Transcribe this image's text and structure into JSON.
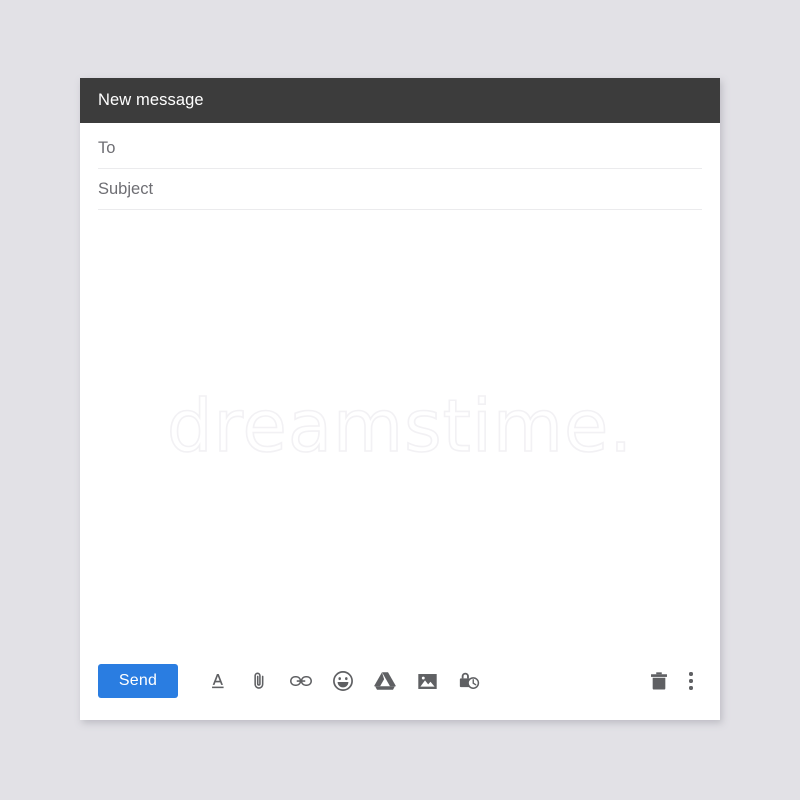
{
  "window": {
    "title": "New message"
  },
  "fields": {
    "to": {
      "label": "To",
      "value": "",
      "placeholder": "To"
    },
    "subject": {
      "label": "Subject",
      "value": "",
      "placeholder": "Subject"
    },
    "body": {
      "value": "",
      "placeholder": ""
    }
  },
  "watermark": {
    "text": "dreamstime."
  },
  "toolbar": {
    "send_label": "Send",
    "tools": [
      {
        "name": "format-options-icon",
        "label": "Formatting options"
      },
      {
        "name": "attach-file-icon",
        "label": "Attach files"
      },
      {
        "name": "insert-link-icon",
        "label": "Insert link"
      },
      {
        "name": "insert-emoji-icon",
        "label": "Insert emoji"
      },
      {
        "name": "google-drive-icon",
        "label": "Insert files using Drive"
      },
      {
        "name": "insert-photo-icon",
        "label": "Insert photo"
      },
      {
        "name": "confidential-mode-icon",
        "label": "Toggle confidential mode"
      }
    ],
    "discard_label": "Discard draft",
    "more_options_label": "More options"
  },
  "colors": {
    "page_background": "#e2e1e6",
    "titlebar_background": "#3c3c3c",
    "titlebar_text": "#ffffff",
    "window_background": "#ffffff",
    "send_button": "#2a7de1",
    "send_button_text": "#ffffff",
    "field_label": "#6e6e73",
    "field_divider": "#ebebed",
    "icon": "#5f6063",
    "watermark": "#f2f1f4"
  }
}
